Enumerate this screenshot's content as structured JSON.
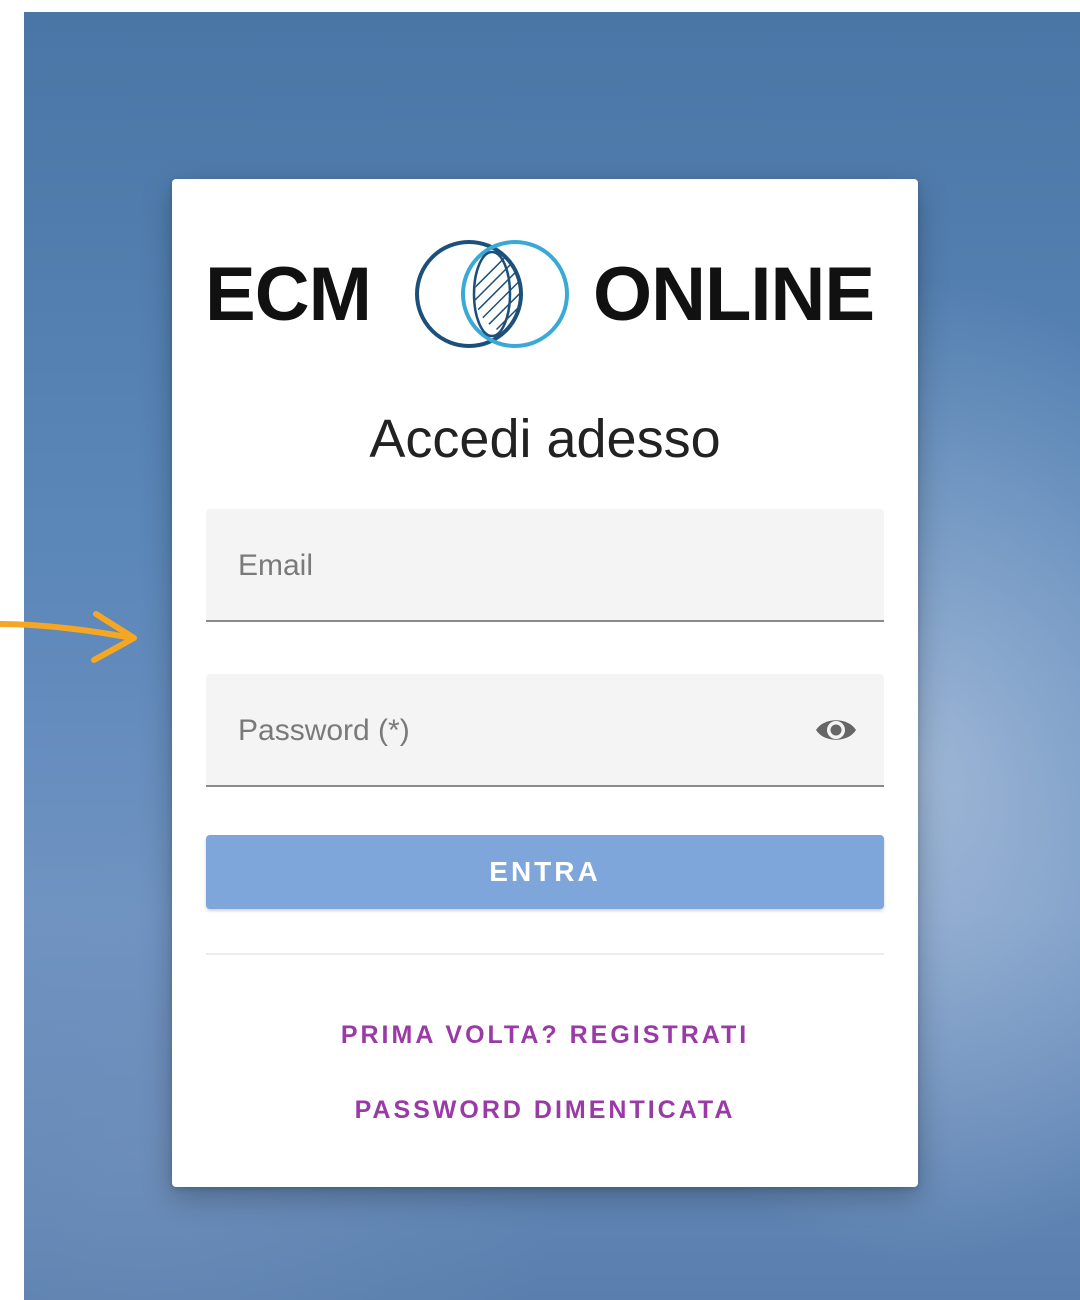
{
  "logo": {
    "left_text": "ECM",
    "right_text": "ONLINE"
  },
  "login": {
    "title": "Accedi adesso",
    "email_placeholder": "Email",
    "password_placeholder": "Password (*)",
    "submit_label": "ENTRA",
    "register_link": "PRIMA VOLTA? REGISTRATI",
    "forgot_link": "PASSWORD DIMENTICATA"
  },
  "icons": {
    "password_toggle": "eye-icon",
    "annotation": "arrow-right-icon"
  },
  "colors": {
    "background": "#5a86b8",
    "button": "#7ea6db",
    "link": "#9a3aa6",
    "arrow": "#f5a623",
    "logo_ring_dark": "#1c4f7a",
    "logo_ring_light": "#3aa9d6"
  }
}
